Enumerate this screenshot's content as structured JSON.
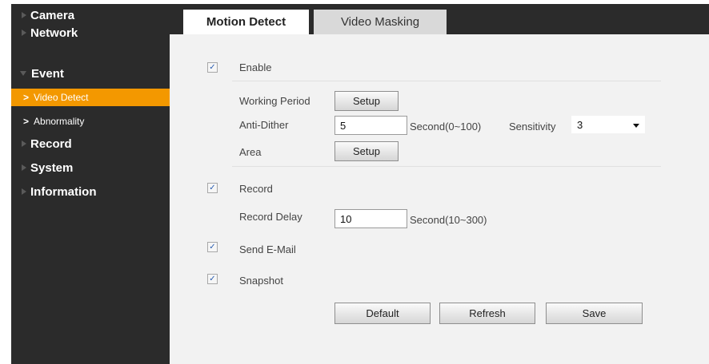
{
  "sidebar": {
    "items": [
      {
        "label": "Camera"
      },
      {
        "label": "Network"
      },
      {
        "label": "Event"
      },
      {
        "label": "Record"
      },
      {
        "label": "System"
      },
      {
        "label": "Information"
      }
    ],
    "event_sub": [
      {
        "label": "Video Detect",
        "active": true
      },
      {
        "label": "Abnormality",
        "active": false
      }
    ]
  },
  "tabs": [
    {
      "label": "Motion Detect",
      "active": true
    },
    {
      "label": "Video Masking",
      "active": false
    }
  ],
  "form": {
    "enable": {
      "label": "Enable",
      "checked": true
    },
    "working_period": {
      "label": "Working Period",
      "button": "Setup"
    },
    "anti_dither": {
      "label": "Anti-Dither",
      "value": "5",
      "unit": "Second(0~100)"
    },
    "sensitivity": {
      "label": "Sensitivity",
      "value": "3"
    },
    "area": {
      "label": "Area",
      "button": "Setup"
    },
    "record": {
      "label": "Record",
      "checked": true
    },
    "record_delay": {
      "label": "Record Delay",
      "value": "10",
      "unit": "Second(10~300)"
    },
    "send_email": {
      "label": "Send E-Mail",
      "checked": true
    },
    "snapshot": {
      "label": "Snapshot",
      "checked": true
    }
  },
  "actions": {
    "default": "Default",
    "refresh": "Refresh",
    "save": "Save"
  },
  "icons": {
    "check": "✓"
  },
  "colors": {
    "sidebar_bg": "#2b2b2b",
    "active_item": "#f39800",
    "content_bg": "#f2f2f2"
  }
}
